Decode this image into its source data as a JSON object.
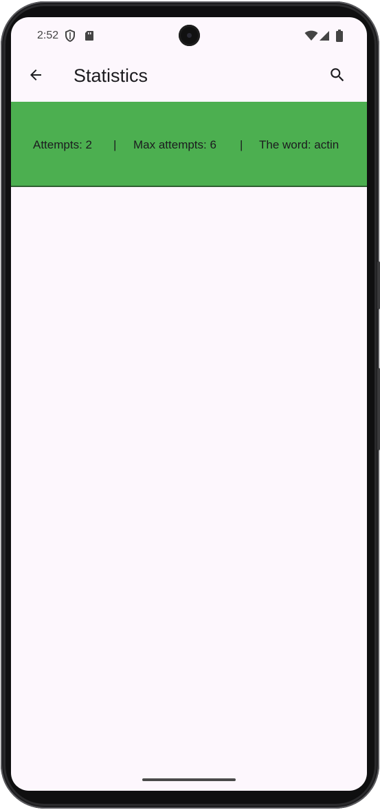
{
  "status_bar": {
    "time": "2:52",
    "icons": [
      "shield-icon",
      "sd-card-icon",
      "wifi-icon",
      "cell-signal-icon",
      "battery-icon"
    ]
  },
  "app_bar": {
    "title": "Statistics",
    "back_icon": "arrow-back-icon",
    "search_icon": "search-icon"
  },
  "stats": {
    "attempts": "Attempts: 2",
    "separator": "|",
    "max_attempts": "Max attempts: 6",
    "word": "The word: actin"
  },
  "colors": {
    "banner": "#4caf50",
    "background": "#fdf7fd",
    "text": "#1c1b1f"
  }
}
